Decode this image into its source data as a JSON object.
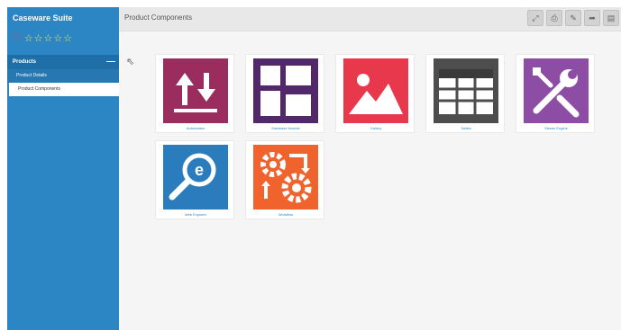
{
  "sidebar": {
    "title": "Caseware Suite",
    "rating": {
      "stars": 5
    },
    "section": "Products",
    "items": [
      {
        "label": "Product Details"
      },
      {
        "label": "Product Components"
      }
    ]
  },
  "header": {
    "title": "Product Components",
    "tools": [
      "expand-icon",
      "print-icon",
      "edit-icon",
      "share-icon",
      "export-icon"
    ]
  },
  "tiles": [
    {
      "label": "Automation",
      "color": "#9b2c5e",
      "icon": "import-export-arrows-icon"
    },
    {
      "label": "Database Module",
      "color": "#51296b",
      "icon": "layout-blocks-icon"
    },
    {
      "label": "Gallery",
      "color": "#e8394c",
      "icon": "image-icon"
    },
    {
      "label": "Tables",
      "color": "#4d4d4d",
      "icon": "table-icon"
    },
    {
      "label": "Viewer Engine",
      "color": "#8e4da5",
      "icon": "tools-icon"
    },
    {
      "label": "Web Explorer",
      "color": "#2b7cbc",
      "icon": "search-e-icon"
    },
    {
      "label": "Workflow",
      "color": "#f0632d",
      "icon": "workflow-gears-icon"
    }
  ]
}
